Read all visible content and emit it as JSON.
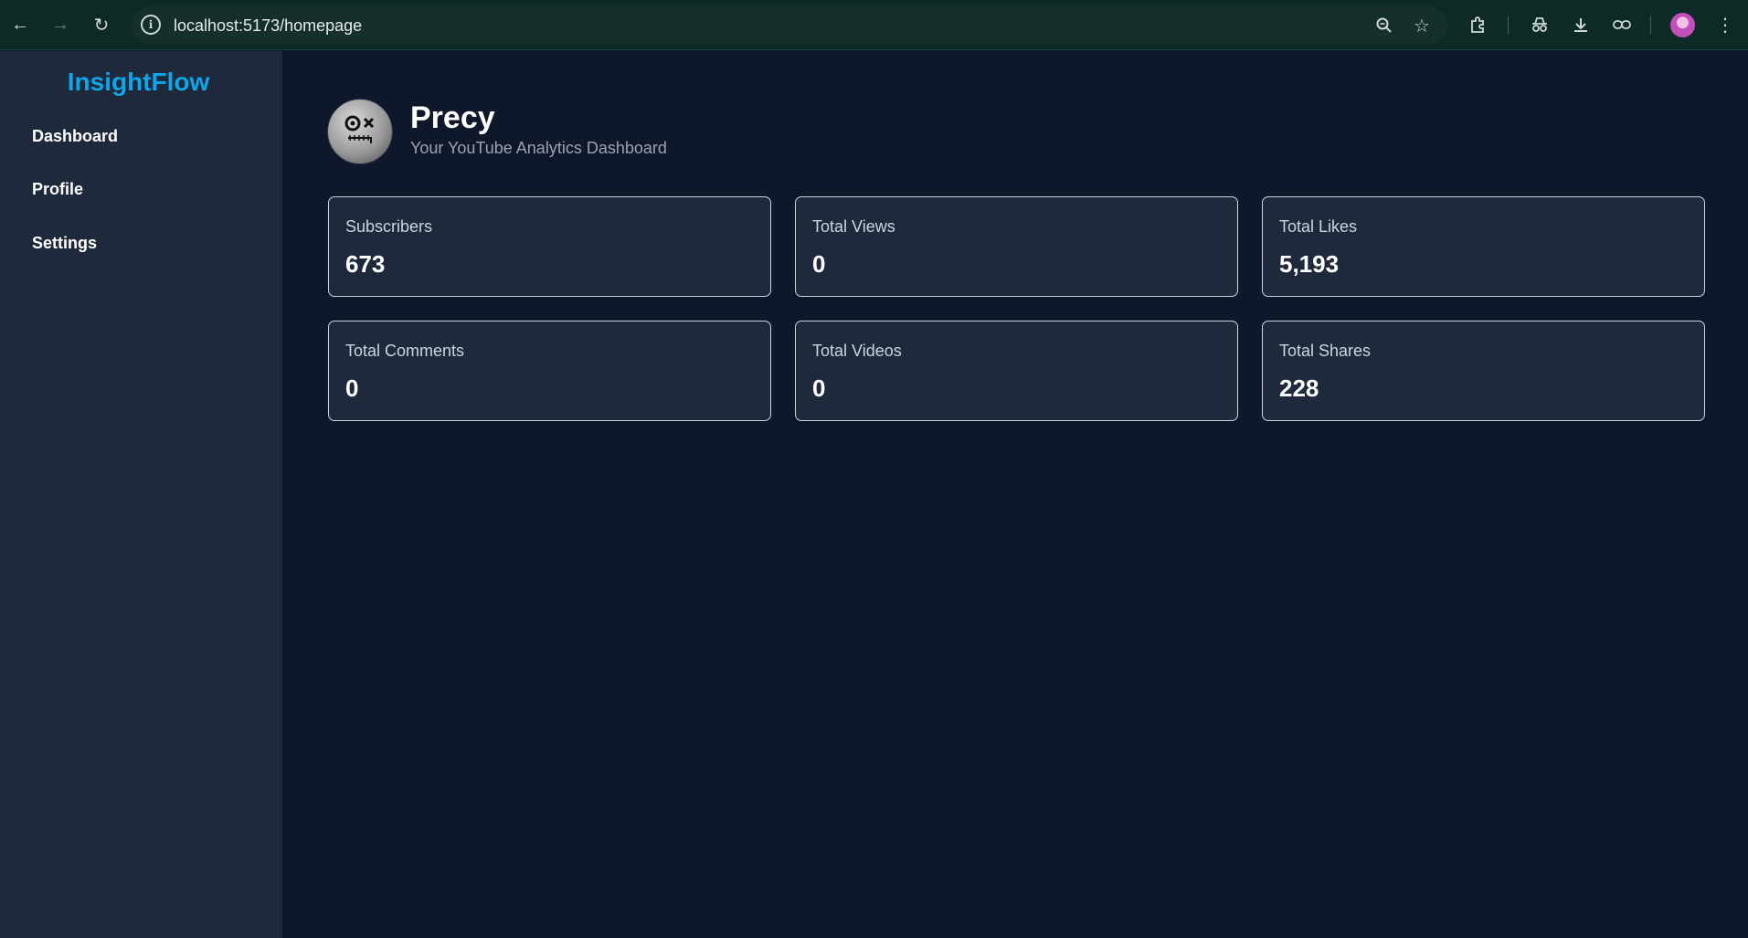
{
  "browser": {
    "url": "localhost:5173/homepage",
    "icons": {
      "back": "arrow-left-icon",
      "forward": "arrow-right-icon",
      "reload": "reload-icon",
      "site_info": "info-icon",
      "zoom": "zoom-icon",
      "bookmark": "star-icon",
      "extensions": "puzzle-icon",
      "incognito": "incognito-icon",
      "downloads": "download-icon",
      "link": "link-icon",
      "menu": "kebab-menu-icon"
    }
  },
  "sidebar": {
    "brand": "InsightFlow",
    "items": [
      {
        "label": "Dashboard"
      },
      {
        "label": "Profile"
      },
      {
        "label": "Settings"
      }
    ]
  },
  "header": {
    "name": "Precy",
    "subtitle": "Your YouTube Analytics Dashboard"
  },
  "stats": [
    {
      "label": "Subscribers",
      "value": "673"
    },
    {
      "label": "Total Views",
      "value": "0"
    },
    {
      "label": "Total Likes",
      "value": "5,193"
    },
    {
      "label": "Total Comments",
      "value": "0"
    },
    {
      "label": "Total Videos",
      "value": "0"
    },
    {
      "label": "Total Shares",
      "value": "228"
    }
  ],
  "colors": {
    "brand": "#0ea5e9",
    "background": "#0f172a",
    "sidebar": "#1e293b",
    "card": "#1e293b",
    "card_border": "#cbd5e1"
  }
}
